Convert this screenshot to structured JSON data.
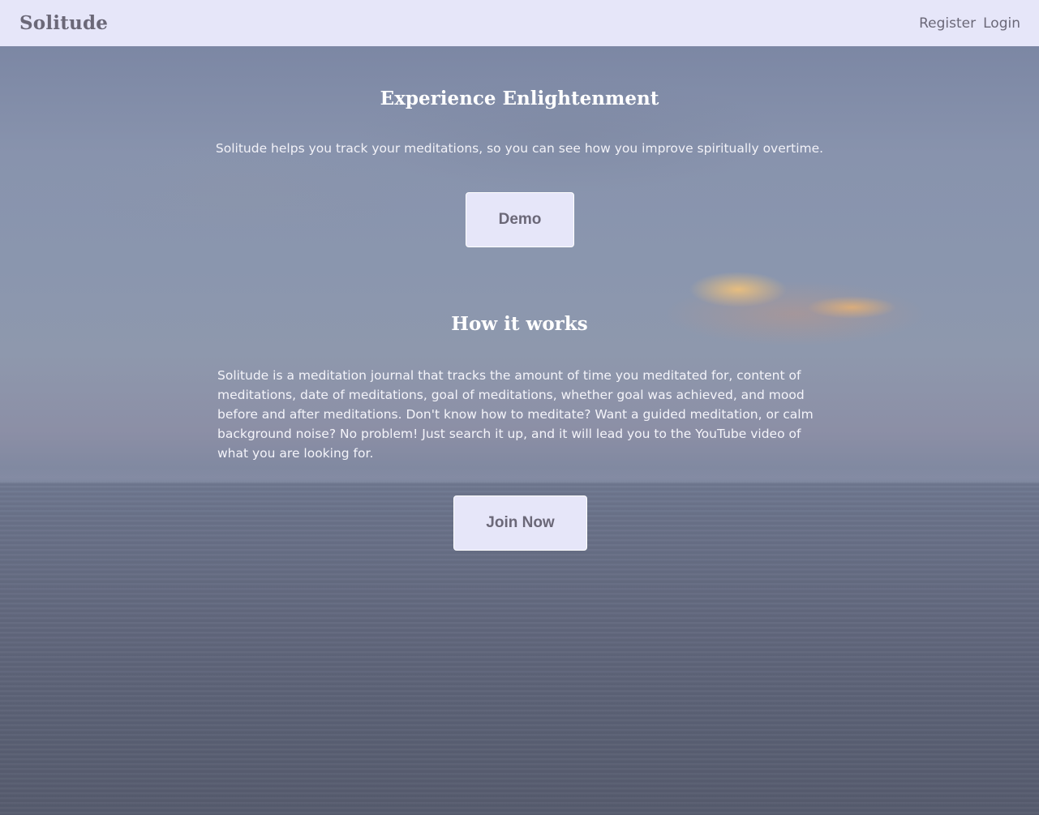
{
  "navbar": {
    "brand": "Solitude",
    "links": [
      "Register",
      "Login"
    ],
    "background": "#e6e6f9",
    "text_color": "#6b6878"
  },
  "hero": {
    "title": "Experience Enlightenment",
    "subtitle": "Solitude helps you track your meditations, so you can see how you improve spiritually overtime.",
    "demo_label": "Demo"
  },
  "how_it_works": {
    "title": "How it works",
    "body": "Solitude is a meditation journal that tracks the amount of time you meditated for, content of meditations, date of meditations, goal of meditations, whether goal was achieved, and mood before and after meditations. Don't know how to meditate? Want a guided meditation, or calm background noise? No problem! Just search it up, and it will lead you to the YouTube video of what you are looking for.",
    "join_label": "Join Now"
  }
}
